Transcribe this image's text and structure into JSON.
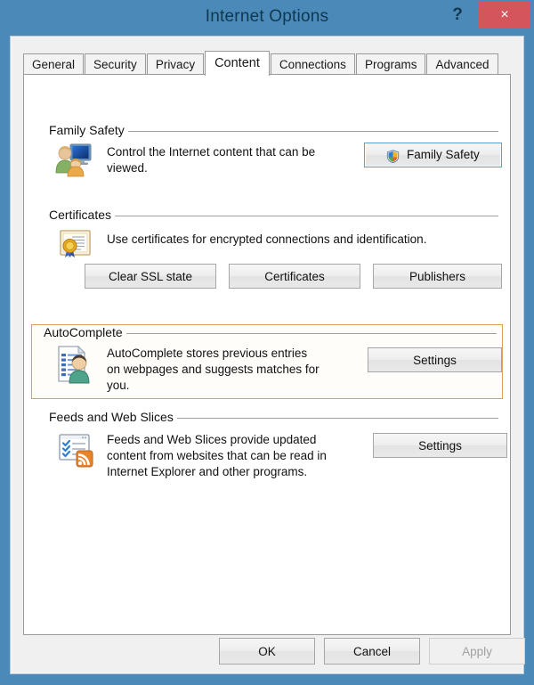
{
  "window": {
    "title": "Internet Options",
    "help_label": "?",
    "close_label": "×"
  },
  "tabs": [
    {
      "label": "General",
      "active": false
    },
    {
      "label": "Security",
      "active": false
    },
    {
      "label": "Privacy",
      "active": false
    },
    {
      "label": "Content",
      "active": true
    },
    {
      "label": "Connections",
      "active": false
    },
    {
      "label": "Programs",
      "active": false
    },
    {
      "label": "Advanced",
      "active": false
    }
  ],
  "groups": {
    "family_safety": {
      "title": "Family Safety",
      "description": "Control the Internet content that can be viewed.",
      "icon": "family-safety-icon",
      "button_label": "Family Safety",
      "button_icon": "uac-shield-icon"
    },
    "certificates": {
      "title": "Certificates",
      "description": "Use certificates for encrypted connections and identification.",
      "icon": "certificate-icon",
      "buttons": [
        {
          "label": "Clear SSL state"
        },
        {
          "label": "Certificates"
        },
        {
          "label": "Publishers"
        }
      ]
    },
    "autocomplete": {
      "title": "AutoComplete",
      "description": "AutoComplete stores previous entries on webpages and suggests matches for you.",
      "icon": "autocomplete-icon",
      "button_label": "Settings",
      "highlighted": true,
      "highlight_color": "#d9a257"
    },
    "feeds": {
      "title": "Feeds and Web Slices",
      "description": "Feeds and Web Slices provide updated content from websites that can be read in Internet Explorer and other programs.",
      "icon": "feeds-icon",
      "button_label": "Settings"
    }
  },
  "footer": {
    "ok_label": "OK",
    "cancel_label": "Cancel",
    "apply_label": "Apply",
    "apply_disabled": true
  },
  "colors": {
    "window_frame": "#4a89b8",
    "close_button": "#d4565c",
    "dialog_background": "#f0f0f0",
    "tabpage_background": "#ffffff",
    "highlight_border": "#d9a257",
    "title_text": "#10384f"
  }
}
